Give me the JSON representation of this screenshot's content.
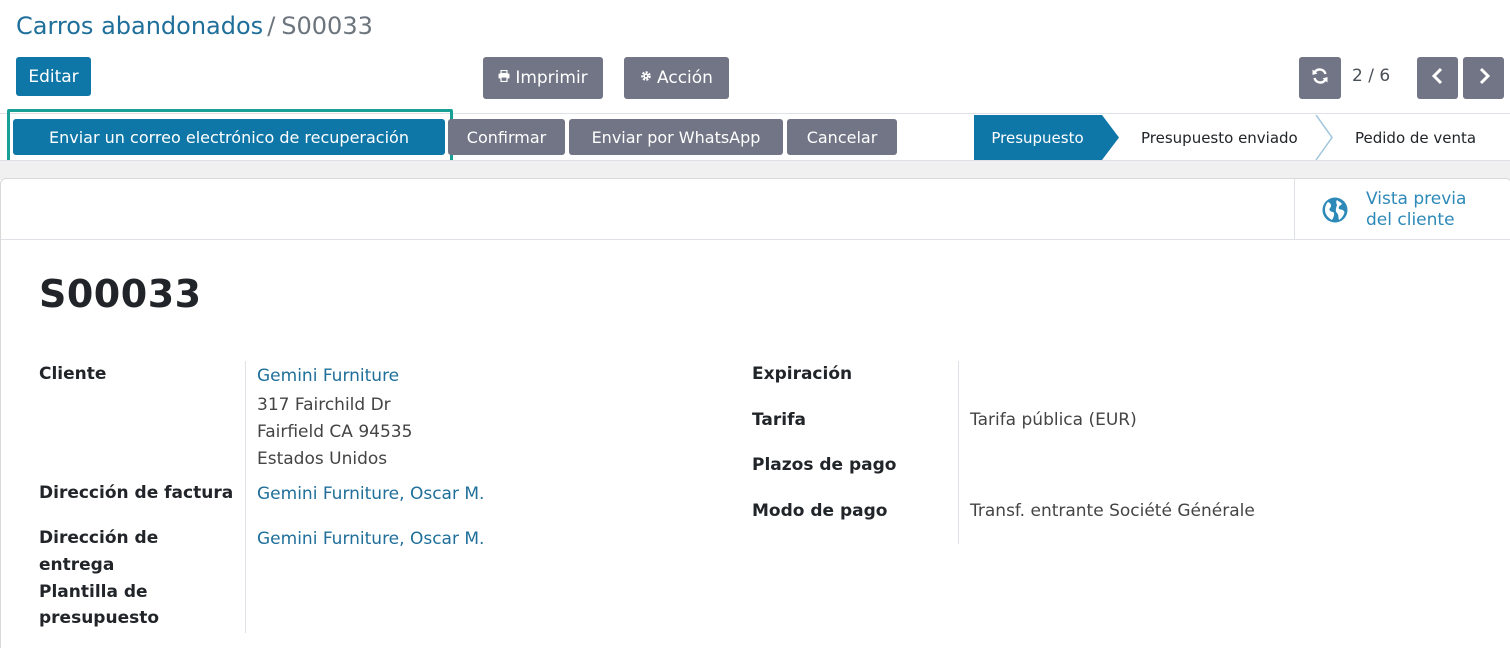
{
  "breadcrumb": {
    "parent": "Carros abandonados",
    "separator": "/",
    "current": "S00033"
  },
  "toolbar": {
    "edit_label": "Editar",
    "print_label": "Imprimir",
    "action_label": "Acción",
    "pager": "2 / 6"
  },
  "statusbar": {
    "buttons": {
      "recover": "Enviar un correo electrónico de recuperación",
      "confirm": "Confirmar",
      "whatsapp": "Enviar por WhatsApp",
      "cancel": "Cancelar"
    },
    "stages": [
      "Presupuesto",
      "Presupuesto enviado",
      "Pedido de venta"
    ],
    "active_stage": "Presupuesto"
  },
  "smart_button": {
    "line1": "Vista previa",
    "line2": "del cliente",
    "icon": "globe-icon"
  },
  "record": {
    "name": "S00033",
    "left": {
      "customer_label": "Cliente",
      "customer_name": "Gemini Furniture",
      "address_line1": "317 Fairchild Dr",
      "address_line2": "Fairfield CA 94535",
      "address_line3": "Estados Unidos",
      "invoice_label": "Dirección de factura",
      "invoice_value": "Gemini Furniture, Oscar M.",
      "delivery_label_1": "Dirección de",
      "delivery_label_2": "entrega",
      "delivery_value": "Gemini Furniture, Oscar M.",
      "template_label_1": "Plantilla de",
      "template_label_2": "presupuesto"
    },
    "right": {
      "expiration_label": "Expiración",
      "pricelist_label": "Tarifa",
      "pricelist_value": "Tarifa pública (EUR)",
      "terms_label": "Plazos de pago",
      "payment_mode_label": "Modo de pago",
      "payment_mode_value": "Transf. entrante Société Générale"
    }
  },
  "colors": {
    "primary": "#0f76a8",
    "secondary": "#717585",
    "highlight": "#18a097",
    "link": "#1f6f9a"
  }
}
